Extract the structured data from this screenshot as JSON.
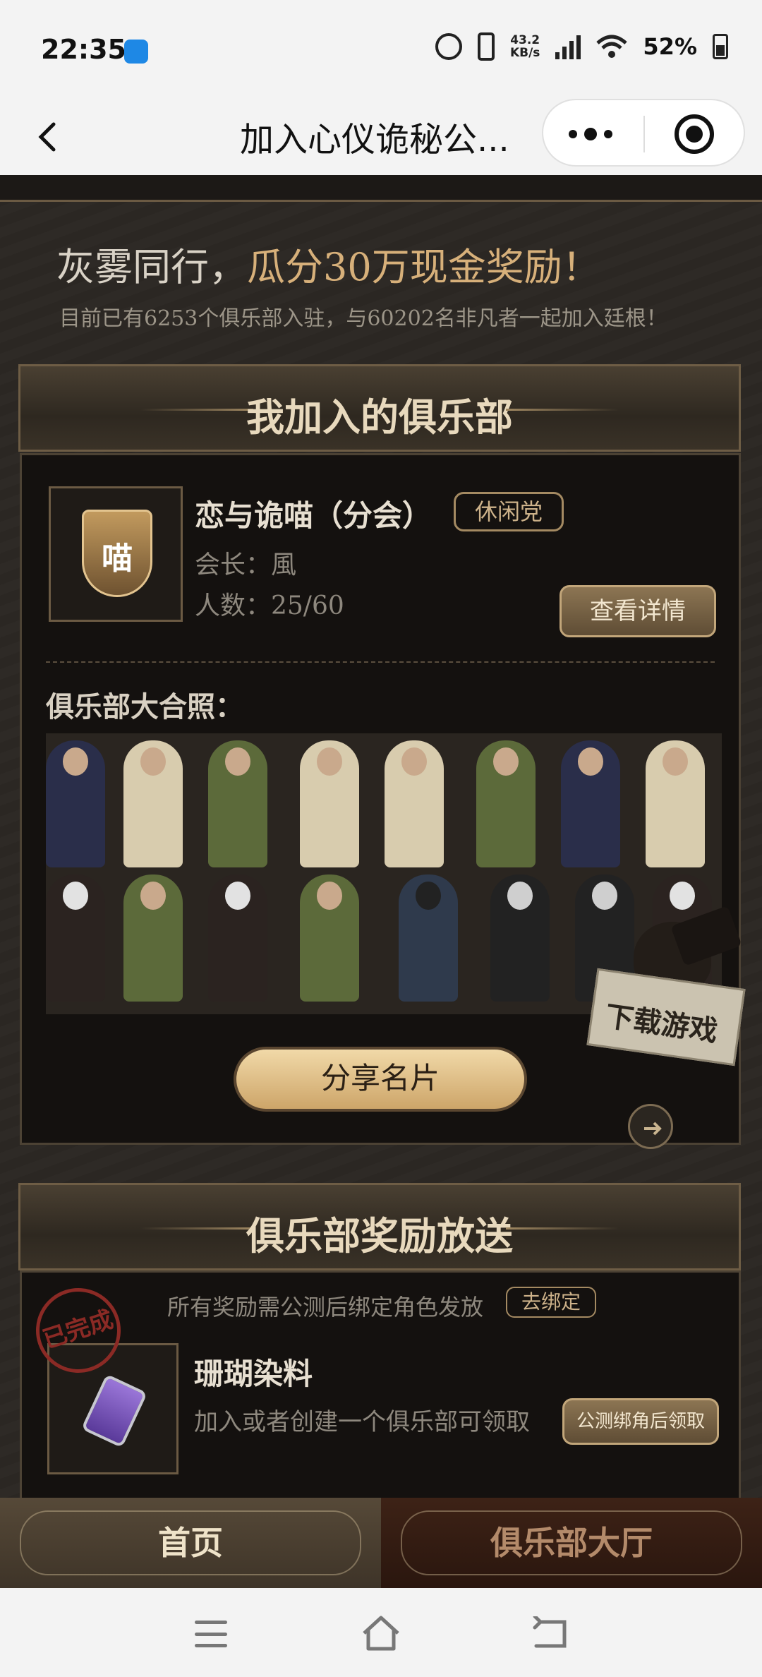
{
  "status_bar": {
    "time": "22:35",
    "net_speed_value": "43.2",
    "net_speed_unit": "KB/s",
    "network": "5G",
    "battery": "52%"
  },
  "nav": {
    "title": "加入心仪诡秘公..."
  },
  "header": {
    "headline_prefix": "灰雾同行，",
    "headline_accent": "瓜分30万现金奖励！",
    "subline": "目前已有6253个俱乐部入驻，与60202名非凡者一起加入廷根！"
  },
  "my_club": {
    "section_title": "我加入的俱乐部",
    "emblem_text": "喵",
    "name": "恋与诡喵（分会）",
    "tag": "休闲党",
    "leader": "会长：風",
    "count": "人数：25/60",
    "detail_button": "查看详情",
    "photo_title": "俱乐部大合照：",
    "share_button": "分享名片",
    "download_label": "下载游戏"
  },
  "rewards": {
    "section_title": "俱乐部奖励放送",
    "note": "所有奖励需公测后绑定角色发放",
    "rebind_button": "去绑定",
    "stamp_text": "已完成",
    "item_title": "珊瑚染料",
    "item_desc": "加入或者创建一个俱乐部可领取",
    "claim_button": "公测绑角后领取"
  },
  "bottom_tabs": {
    "home": "首页",
    "hall": "俱乐部大厅"
  },
  "colors": {
    "accent_gold": "#d7b07a",
    "panel_bg": "#14110f",
    "page_bg": "#2a2622"
  }
}
